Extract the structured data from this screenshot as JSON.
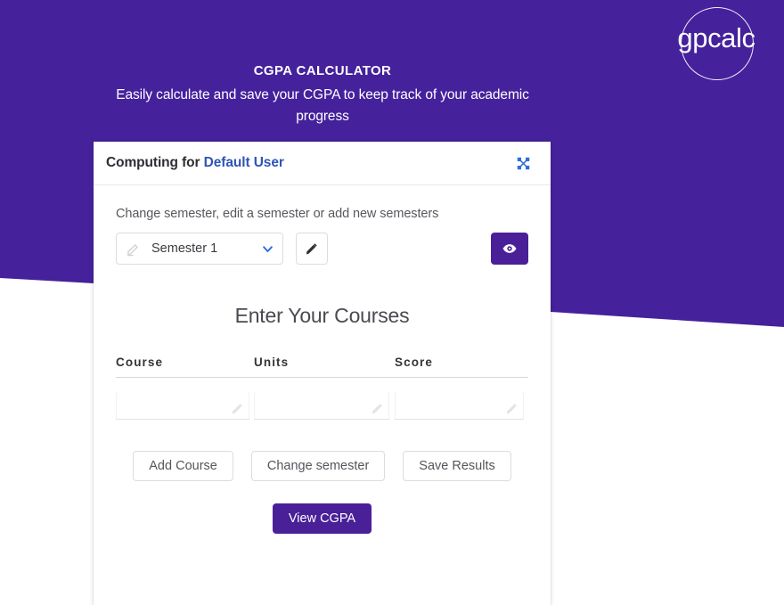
{
  "theme": {
    "purple": "#4a2099",
    "backdrop_purple": "#45219c",
    "accent_blue": "#2f55b5",
    "chevron_blue": "#2f6fd8",
    "white": "#ffffff"
  },
  "logo": {
    "text": "gpcalc",
    "ring_icon": "circle-outline-icon"
  },
  "header": {
    "title": "CGPA CALCULATOR",
    "subtitle": "Easily calculate and save your CGPA to keep track of your academic progress"
  },
  "card": {
    "header": {
      "prefix": "Computing for ",
      "user": "Default User",
      "shuffle_icon": "shuffle-icon"
    },
    "semester": {
      "instruction": "Change semester, edit a semester or add new semesters",
      "select_value": "Semester 1",
      "select_options": [
        "Semester 1"
      ],
      "select_icon": "pencil-icon",
      "chevron_icon": "chevron-down-icon",
      "edit_button_icon": "pencil-icon",
      "preview_button_icon": "eye-icon"
    },
    "courses": {
      "title": "Enter Your Courses",
      "columns": [
        "Course",
        "Units",
        "Score"
      ],
      "rows": [
        {
          "course": "",
          "course_placeholder": "",
          "units": "",
          "units_placeholder": "",
          "score": "",
          "score_placeholder": "",
          "field_icon": "pencil-icon"
        }
      ]
    },
    "actions": {
      "add_course": "Add Course",
      "change_semester": "Change semester",
      "save_results": "Save Results",
      "view_cgpa": "View CGPA"
    }
  }
}
